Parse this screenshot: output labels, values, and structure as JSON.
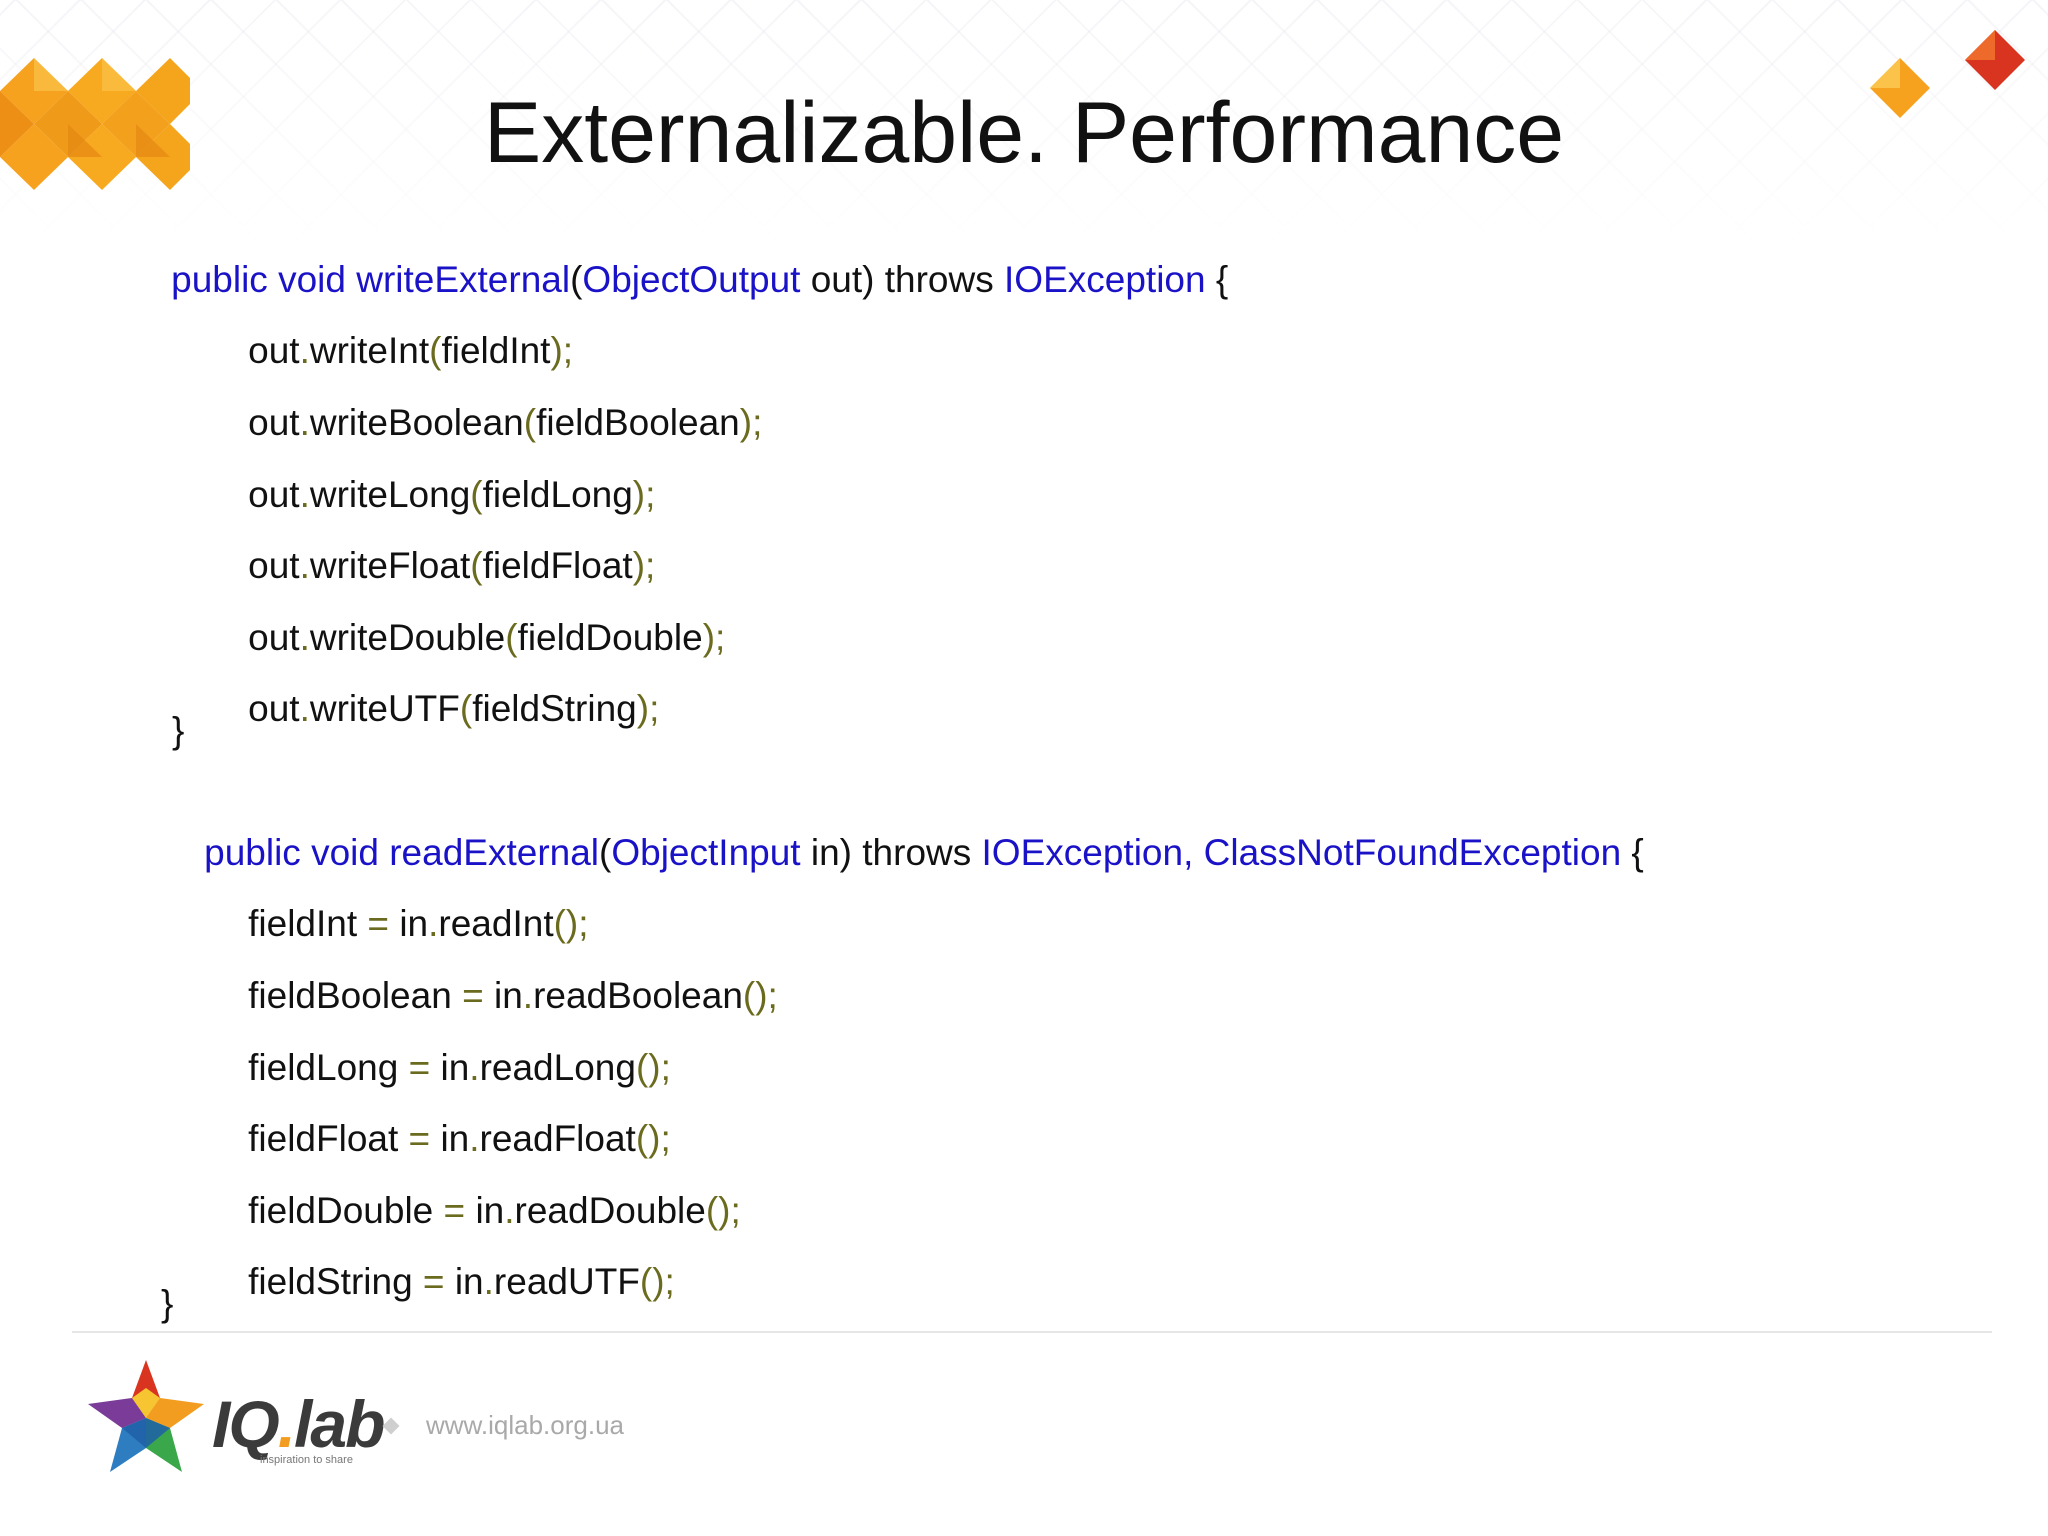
{
  "slide": {
    "title": "Externalizable. Performance"
  },
  "code": {
    "write_header": {
      "prefix": "public void writeExternal",
      "paren_open": "(",
      "type": "ObjectOutput",
      "rest": " out) throws ",
      "exception": "IOException",
      "brace": " {"
    },
    "write_lines": [
      {
        "obj": "out",
        "dot": ".",
        "method": "writeInt",
        "open": "(",
        "arg": "fieldInt",
        "close": ");"
      },
      {
        "obj": "out",
        "dot": ".",
        "method": "writeBoolean",
        "open": "(",
        "arg": "fieldBoolean",
        "close": ");"
      },
      {
        "obj": "out",
        "dot": ".",
        "method": "writeLong",
        "open": "(",
        "arg": "fieldLong",
        "close": ");"
      },
      {
        "obj": "out",
        "dot": ".",
        "method": "writeFloat",
        "open": "(",
        "arg": "fieldFloat",
        "close": ");"
      },
      {
        "obj": "out",
        "dot": ".",
        "method": "writeDouble",
        "open": "(",
        "arg": "fieldDouble",
        "close": ");"
      },
      {
        "obj": "out",
        "dot": ".",
        "method": "writeUTF",
        "open": "(",
        "arg": "fieldString",
        "close": ");"
      }
    ],
    "write_close": "}",
    "read_header": {
      "prefix": "public void readExternal",
      "paren_open": "(",
      "type": "ObjectInput",
      "rest": " in) throws ",
      "exception1": "IOException,",
      "exception2": "ClassNotFoundException",
      "brace": " {"
    },
    "read_lines": [
      {
        "field": "fieldInt",
        "eq": " = ",
        "obj": "in",
        "dot": ".",
        "method": "readInt",
        "tail": "();"
      },
      {
        "field": "fieldBoolean",
        "eq": " = ",
        "obj": "in",
        "dot": ".",
        "method": "readBoolean",
        "tail": "();"
      },
      {
        "field": "fieldLong",
        "eq": " = ",
        "obj": "in",
        "dot": ".",
        "method": "readLong",
        "tail": "();"
      },
      {
        "field": "fieldFloat",
        "eq": " = ",
        "obj": "in",
        "dot": ".",
        "method": "readFloat",
        "tail": "();"
      },
      {
        "field": "fieldDouble",
        "eq": " = ",
        "obj": "in",
        "dot": ".",
        "method": "readDouble",
        "tail": "();"
      },
      {
        "field": "fieldString",
        "eq": " = ",
        "obj": "in",
        "dot": ".",
        "method": "readUTF",
        "tail": "();"
      }
    ],
    "read_close": "}"
  },
  "footer": {
    "brand_main": "IQ",
    "brand_dot": ".",
    "brand_suffix": "lab",
    "tagline": "inspiration to share",
    "url": "www.iqlab.org.ua"
  },
  "colors": {
    "keyword": "#1a12c7",
    "punctuation": "#6b6b1f",
    "text": "#111111",
    "accent_orange": "#f29d1f",
    "accent_red": "#d9341f"
  },
  "icons": [
    "orange-diamond-pattern-icon",
    "orange-red-diamonds-icon",
    "iqlab-star-logo-icon"
  ]
}
